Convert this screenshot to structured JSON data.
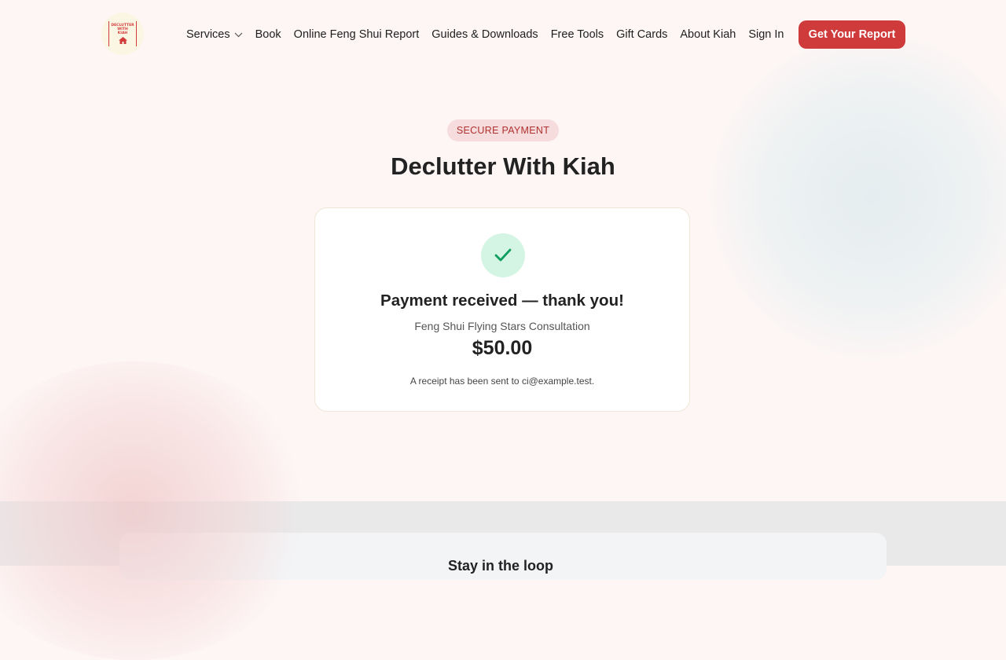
{
  "brand": {
    "logo_lines": [
      "DECLUTTER",
      "WITH",
      "KIAH"
    ],
    "colors": {
      "accent": "#cf3a3b",
      "success": "#0d9e5f",
      "background": "#fdf6f5"
    }
  },
  "nav": {
    "items": [
      {
        "label": "Services",
        "has_dropdown": true
      },
      {
        "label": "Book"
      },
      {
        "label": "Online Feng Shui Report"
      },
      {
        "label": "Guides & Downloads"
      },
      {
        "label": "Free Tools"
      },
      {
        "label": "Gift Cards"
      },
      {
        "label": "About Kiah"
      },
      {
        "label": "Sign In"
      }
    ],
    "cta_label": "Get Your Report"
  },
  "hero": {
    "badge": "SECURE PAYMENT",
    "title": "Declutter With Kiah"
  },
  "confirmation": {
    "icon": "check-icon",
    "heading": "Payment received — thank you!",
    "product": "Feng Shui Flying Stars Consultation",
    "amount": "$50.00",
    "receipt_note": "A receipt has been sent to ci@example.test."
  },
  "lower_section": {
    "title": "Stay in the loop"
  }
}
